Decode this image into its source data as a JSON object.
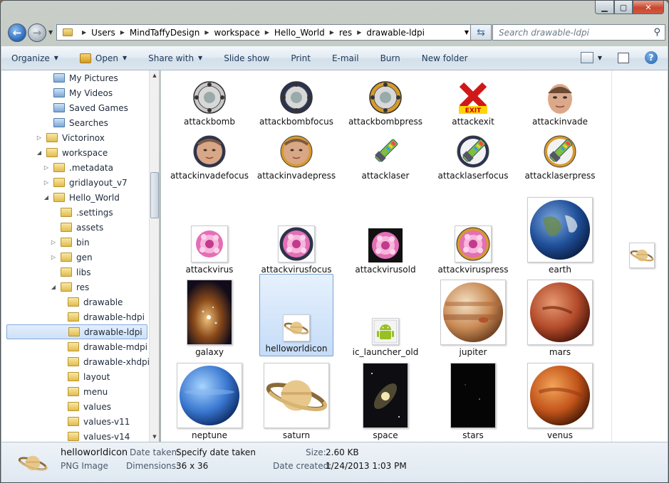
{
  "window": {
    "caption": {
      "minimize": "▁",
      "maximize": "▢",
      "close": "✕"
    }
  },
  "address": {
    "crumbs": [
      "Users",
      "MindTaffyDesign",
      "workspace",
      "Hello_World",
      "res",
      "drawable-ldpi"
    ],
    "search_placeholder": "Search drawable-ldpi"
  },
  "toolbar": {
    "organize": "Organize",
    "open": "Open",
    "share_with": "Share with",
    "slide_show": "Slide show",
    "print": "Print",
    "email": "E-mail",
    "burn": "Burn",
    "new_folder": "New folder"
  },
  "tree": [
    {
      "label": "My Pictures",
      "special": true
    },
    {
      "label": "My Videos",
      "special": true
    },
    {
      "label": "Saved Games",
      "special": true
    },
    {
      "label": "Searches",
      "special": true
    },
    {
      "label": "Victorinox",
      "expander": "closed"
    },
    {
      "label": "workspace",
      "expander": "open"
    },
    {
      "label": ".metadata",
      "expander": "closed"
    },
    {
      "label": "gridlayout_v7",
      "expander": "closed"
    },
    {
      "label": "Hello_World",
      "expander": "open"
    },
    {
      "label": ".settings"
    },
    {
      "label": "assets"
    },
    {
      "label": "bin",
      "expander": "closed"
    },
    {
      "label": "gen",
      "expander": "closed"
    },
    {
      "label": "libs"
    },
    {
      "label": "res",
      "expander": "open"
    },
    {
      "label": "drawable"
    },
    {
      "label": "drawable-hdpi"
    },
    {
      "label": "drawable-ldpi",
      "selected": true
    },
    {
      "label": "drawable-mdpi"
    },
    {
      "label": "drawable-xhdpi"
    },
    {
      "label": "layout"
    },
    {
      "label": "menu"
    },
    {
      "label": "values"
    },
    {
      "label": "values-v11"
    },
    {
      "label": "values-v14"
    }
  ],
  "files": [
    {
      "name": "attackbomb",
      "kind": "bomb"
    },
    {
      "name": "attackbombfocus",
      "kind": "bombfocus"
    },
    {
      "name": "attackbombpress",
      "kind": "bombpress"
    },
    {
      "name": "attackexit",
      "kind": "exit"
    },
    {
      "name": "attackinvade",
      "kind": "face"
    },
    {
      "name": "attackinvadefocus",
      "kind": "facefocus"
    },
    {
      "name": "attackinvadepress",
      "kind": "facepress"
    },
    {
      "name": "attacklaser",
      "kind": "laser"
    },
    {
      "name": "attacklaserfocus",
      "kind": "laserfocus"
    },
    {
      "name": "attacklaserpress",
      "kind": "laserpress"
    },
    {
      "name": "attackvirus",
      "kind": "virus"
    },
    {
      "name": "attackvirusfocus",
      "kind": "virusfocus"
    },
    {
      "name": "attackvirusold",
      "kind": "virusold"
    },
    {
      "name": "attackviruspress",
      "kind": "viruspress"
    },
    {
      "name": "earth",
      "kind": "earth"
    },
    {
      "name": "galaxy",
      "kind": "galaxy"
    },
    {
      "name": "helloworldicon",
      "kind": "saturn-small",
      "selected": true
    },
    {
      "name": "ic_launcher_old",
      "kind": "android"
    },
    {
      "name": "jupiter",
      "kind": "jupiter"
    },
    {
      "name": "mars",
      "kind": "mars"
    },
    {
      "name": "neptune",
      "kind": "neptune"
    },
    {
      "name": "saturn",
      "kind": "saturn"
    },
    {
      "name": "space",
      "kind": "space"
    },
    {
      "name": "stars",
      "kind": "stars"
    },
    {
      "name": "venus",
      "kind": "venus"
    }
  ],
  "details": {
    "name": "helloworldicon",
    "type": "PNG Image",
    "date_taken_label": "Date taken:",
    "date_taken_value": "Specify date taken",
    "dimensions_label": "Dimensions:",
    "dimensions_value": "36 x 36",
    "size_label": "Size:",
    "size_value": "2.60 KB",
    "date_created_label": "Date created:",
    "date_created_value": "1/24/2013 1:03 PM"
  }
}
